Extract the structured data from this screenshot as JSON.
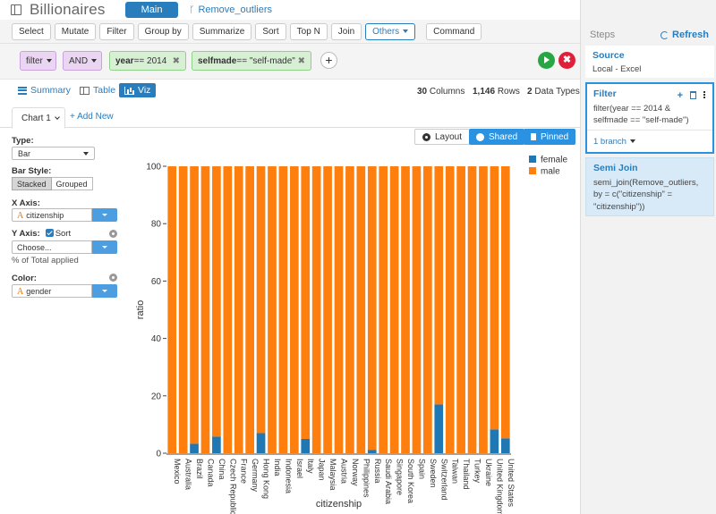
{
  "app": {
    "title": "Billionaires",
    "branch_main": "Main",
    "branch_other": "Remove_outliers"
  },
  "toolbar": {
    "buttons": [
      "Select",
      "Mutate",
      "Filter",
      "Group by",
      "Summarize",
      "Sort",
      "Top N",
      "Join"
    ],
    "others_label": "Others",
    "command_label": "Command"
  },
  "filter_row": {
    "filter_label": "filter",
    "and_label": "AND",
    "cond1_field": "year",
    "cond1_rest": " == 2014",
    "cond2_field": "selfmade",
    "cond2_rest": " == \"self-made\"",
    "close_glyph": "✖",
    "add_glyph": "+",
    "stop_glyph": "✖"
  },
  "view_tabs": {
    "summary": "Summary",
    "table": "Table",
    "viz": "Viz",
    "columns_num": "30",
    "columns_label": "Columns",
    "rows_num": "1,146",
    "rows_label": "Rows",
    "types_num": "2",
    "types_label": "Data Types"
  },
  "chart_tabs": {
    "tab_label": "Chart 1",
    "add_label": "+ Add New"
  },
  "config": {
    "type_label": "Type:",
    "type_value": "Bar",
    "bar_style_label": "Bar Style:",
    "stacked": "Stacked",
    "grouped": "Grouped",
    "x_axis_label": "X Axis:",
    "x_axis_value": "citizenship",
    "y_axis_label": "Y Axis:",
    "sort_label": "Sort",
    "y_axis_value": "Choose...",
    "y_axis_note": "% of Total applied",
    "color_label": "Color:",
    "color_value": "gender",
    "string_glyph": "A"
  },
  "chart_buttons": {
    "layout": "Layout",
    "shared": "Shared",
    "pinned": "Pinned"
  },
  "steps": {
    "title": "Steps",
    "refresh": "Refresh",
    "source_title": "Source",
    "source_sub": "Local - Excel",
    "filter_title": "Filter",
    "filter_expr": "filter(year == 2014 & selfmade == \"self-made\")",
    "branch_label": "1 branch",
    "semi_title": "Semi Join",
    "semi_expr": "semi_join(Remove_outliers, by = c(\"citizenship\" = \"citizenship\"))"
  },
  "colors": {
    "female": "#1f77b4",
    "male": "#ff7f0e",
    "accent": "#2a7dbd"
  },
  "chart_data": {
    "type": "bar",
    "stacked": true,
    "xlabel": "citizenship",
    "ylabel": "ratio",
    "ylim": [
      0,
      100
    ],
    "yticks": [
      0,
      20,
      40,
      60,
      80,
      100
    ],
    "legend_position": "top-right",
    "categories": [
      "Mexico",
      "Australia",
      "Brazil",
      "Canada",
      "China",
      "Czech Republic",
      "France",
      "Germany",
      "Hong Kong",
      "India",
      "Indonesia",
      "Israel",
      "Italy",
      "Japan",
      "Malaysia",
      "Austria",
      "Norway",
      "Philippines",
      "Russia",
      "Saudi Arabia",
      "Singapore",
      "South Korea",
      "Spain",
      "Sweden",
      "Switzerland",
      "Taiwan",
      "Thailand",
      "Turkey",
      "Ukraine",
      "United Kingdom",
      "United States"
    ],
    "series": [
      {
        "name": "female",
        "values": [
          0,
          0,
          3.3,
          0,
          5.8,
          0,
          0,
          0,
          7,
          0,
          0,
          0,
          5,
          0,
          0,
          0,
          0,
          0,
          1.2,
          0,
          0,
          0,
          0,
          0,
          17,
          0,
          0,
          0,
          0,
          8.3,
          5.2
        ]
      },
      {
        "name": "male",
        "values": [
          100,
          100,
          96.7,
          100,
          94.2,
          100,
          100,
          100,
          93,
          100,
          100,
          100,
          95,
          100,
          100,
          100,
          100,
          100,
          98.8,
          100,
          100,
          100,
          100,
          100,
          83,
          100,
          100,
          100,
          100,
          91.7,
          94.8
        ]
      }
    ]
  }
}
